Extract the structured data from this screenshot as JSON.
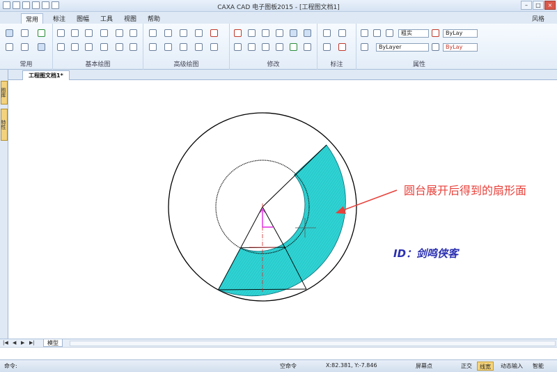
{
  "window": {
    "title": "CAXA CAD 电子图板2015 - [工程图文档1]",
    "style_label": "风格",
    "min": "–",
    "max": "□",
    "close": "×"
  },
  "quick_access": [
    "new-icon",
    "open-icon",
    "save-icon",
    "print-icon",
    "undo-icon",
    "redo-icon"
  ],
  "ribbon": {
    "tabs": [
      "常用",
      "标注",
      "图幅",
      "工具",
      "视图",
      "帮助"
    ],
    "active_tab": "常用",
    "groups": [
      "常用",
      "基本绘图",
      "高级绘图",
      "修改",
      "标注",
      "属性"
    ],
    "properties": {
      "linetype": "ByLayer",
      "linewidth": "粗实",
      "color1": "ByLay",
      "color2": "ByLay"
    }
  },
  "document": {
    "tab": "工程图文档1*",
    "tab_close": "×"
  },
  "left_panels": [
    "图库",
    "特性"
  ],
  "layout": {
    "tab": "模型",
    "nav": [
      "|◀",
      "◀",
      "▶",
      "▶|"
    ]
  },
  "drawing": {
    "annotation": "圆台展开后得到的扇形面",
    "watermark": "ID：剑鸣侠客",
    "fill_color": "#2fd3d3",
    "arrow_color": "#e8403a",
    "watermark_color": "#2a2fb0"
  },
  "command": {
    "prompt": "命令:",
    "empty_command": "空命令",
    "coords": "X:82.381, Y:-7.846",
    "snap": "屏幕点"
  },
  "status_buttons": [
    {
      "label": "正交",
      "on": false
    },
    {
      "label": "线宽",
      "on": true
    },
    {
      "label": "动态输入",
      "on": false
    },
    {
      "label": "智能",
      "on": false
    }
  ]
}
